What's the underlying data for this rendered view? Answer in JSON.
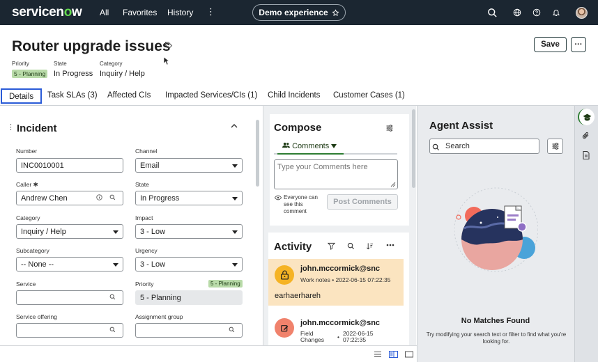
{
  "nav": {
    "logo_pre": "servicen",
    "logo_o": "o",
    "logo_post": "w",
    "all": "All",
    "favorites": "Favorites",
    "history": "History",
    "more": "⋮",
    "demo": "Demo experience"
  },
  "record": {
    "title": "Router upgrade issues",
    "priority_label": "Priority",
    "priority_badge": "5 - Planning",
    "state_label": "State",
    "state_value": "In Progress",
    "category_label": "Category",
    "category_value": "Inquiry / Help",
    "save_label": "Save",
    "more_label": "···"
  },
  "tabs": [
    "Details",
    "Task SLAs (3)",
    "Affected CIs",
    "Impacted Services/CIs (1)",
    "Child Incidents",
    "Customer Cases (1)"
  ],
  "incident": {
    "title": "Incident",
    "fields": {
      "number": {
        "label": "Number",
        "value": "INC0010001"
      },
      "channel": {
        "label": "Channel",
        "value": "Email"
      },
      "caller": {
        "label": "Caller ✱",
        "value": "Andrew Chen"
      },
      "state": {
        "label": "State",
        "value": "In Progress"
      },
      "category": {
        "label": "Category",
        "value": "Inquiry / Help"
      },
      "impact": {
        "label": "Impact",
        "value": "3 - Low"
      },
      "subcategory": {
        "label": "Subcategory",
        "value": "-- None --"
      },
      "urgency": {
        "label": "Urgency",
        "value": "3 - Low"
      },
      "service": {
        "label": "Service",
        "value": ""
      },
      "priority": {
        "label": "Priority",
        "value": "5 - Planning",
        "badge": "5 - Planning"
      },
      "service_offering": {
        "label": "Service offering",
        "value": ""
      },
      "assignment_group": {
        "label": "Assignment group",
        "value": ""
      }
    }
  },
  "compose": {
    "title": "Compose",
    "tab_label": "Comments",
    "placeholder": "Type your Comments here",
    "visibility": "Everyone can see this comment",
    "post_label": "Post Comments"
  },
  "activity": {
    "title": "Activity",
    "entries": [
      {
        "author": "john.mccormick@snc",
        "type": "Work notes",
        "time": "2022-06-15 07:22:35",
        "text": "earhaerhareh"
      },
      {
        "author": "john.mccormick@snc",
        "type_line1": "Field",
        "type_line2": "Changes",
        "time_line1": "2022-06-15",
        "time_line2": "07:22:35"
      }
    ]
  },
  "agent_assist": {
    "title": "Agent Assist",
    "search_placeholder": "Search",
    "empty_title": "No Matches Found",
    "empty_sub": "Try modifying your search text or filter to find what you're looking for."
  },
  "colors": {
    "nav_bg": "#1b2631",
    "accent_green": "#62d84e",
    "tab_active": "#2a5bd7",
    "priority_badge": "#b9dba9",
    "work_note_bg": "#fbe4c0"
  }
}
